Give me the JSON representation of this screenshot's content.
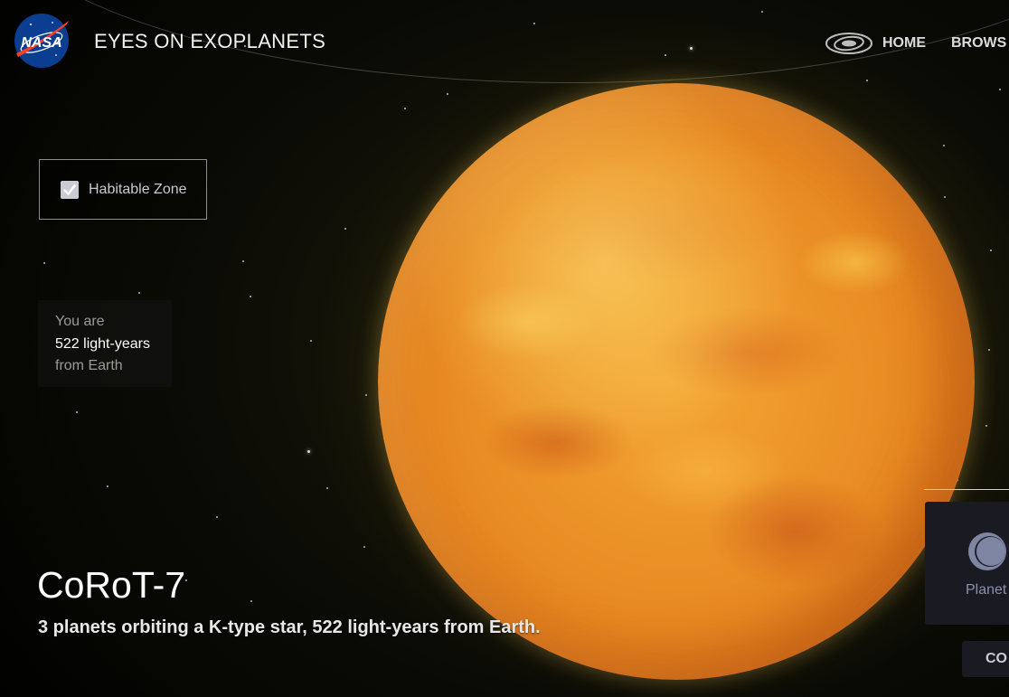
{
  "header": {
    "logo_text": "NASA",
    "app_title": "EYES ON EXOPLANETS",
    "nav": {
      "home_label": "HOME",
      "browse_label": "BROWS"
    }
  },
  "habitable_zone": {
    "label": "Habitable Zone",
    "checked": true
  },
  "distance_panel": {
    "line1": "You are",
    "line2": "522 light-years",
    "line3": "from Earth"
  },
  "system": {
    "name": "CoRoT-7",
    "description": "3 planets orbiting a K-type star, 522 light-years from Earth."
  },
  "side_panel": {
    "label": "Planet",
    "button_label": "CO"
  },
  "icons": {
    "logo": "nasa-logo",
    "home": "galaxy-icon",
    "checkbox": "check-icon",
    "side": "planet-icon"
  },
  "colors": {
    "background": "#000000",
    "planet_primary": "#e88a22",
    "planet_highlight": "#f6c343",
    "side_card": "#191a22",
    "muted_text": "#9a9a9a"
  }
}
